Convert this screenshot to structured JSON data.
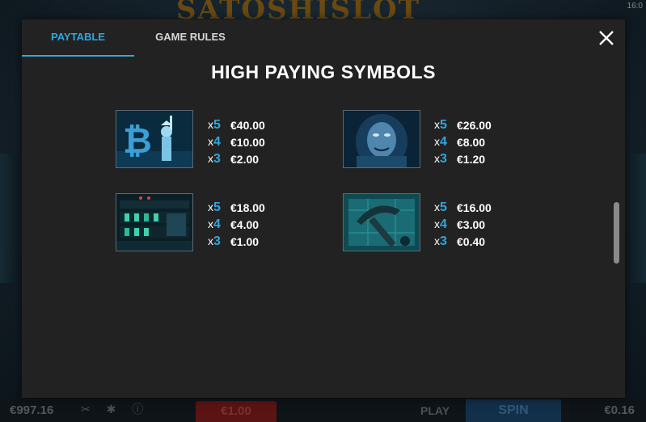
{
  "background": {
    "logo_text": "SATOSHISLOT",
    "clock_text": "16:0",
    "balance": "€997.16",
    "bet": "€1.00",
    "play_label": "PLAY",
    "spin_label": "SPIN",
    "win": "€0.16",
    "icons": "✂ ✱ ⓘ"
  },
  "tabs": [
    {
      "label": "PAYTABLE",
      "active": true
    },
    {
      "label": "GAME RULES",
      "active": false
    }
  ],
  "section_title": "HIGH PAYING SYMBOLS",
  "symbols": [
    {
      "icon": "bitcoin-liberty-symbol-icon",
      "pays": [
        {
          "x": "x",
          "n": "5",
          "amount": "€40.00"
        },
        {
          "x": "x",
          "n": "4",
          "amount": "€10.00"
        },
        {
          "x": "x",
          "n": "3",
          "amount": "€2.00"
        }
      ]
    },
    {
      "icon": "hooded-figure-symbol-icon",
      "pays": [
        {
          "x": "x",
          "n": "5",
          "amount": "€26.00"
        },
        {
          "x": "x",
          "n": "4",
          "amount": "€8.00"
        },
        {
          "x": "x",
          "n": "3",
          "amount": "€1.20"
        }
      ]
    },
    {
      "icon": "server-panel-symbol-icon",
      "pays": [
        {
          "x": "x",
          "n": "5",
          "amount": "€18.00"
        },
        {
          "x": "x",
          "n": "4",
          "amount": "€4.00"
        },
        {
          "x": "x",
          "n": "3",
          "amount": "€1.00"
        }
      ]
    },
    {
      "icon": "pickaxe-chip-symbol-icon",
      "pays": [
        {
          "x": "x",
          "n": "5",
          "amount": "€16.00"
        },
        {
          "x": "x",
          "n": "4",
          "amount": "€3.00"
        },
        {
          "x": "x",
          "n": "3",
          "amount": "€0.40"
        }
      ]
    }
  ],
  "colors": {
    "accent": "#2ea7e0",
    "modal_bg": "#222222",
    "text": "#ffffff"
  }
}
